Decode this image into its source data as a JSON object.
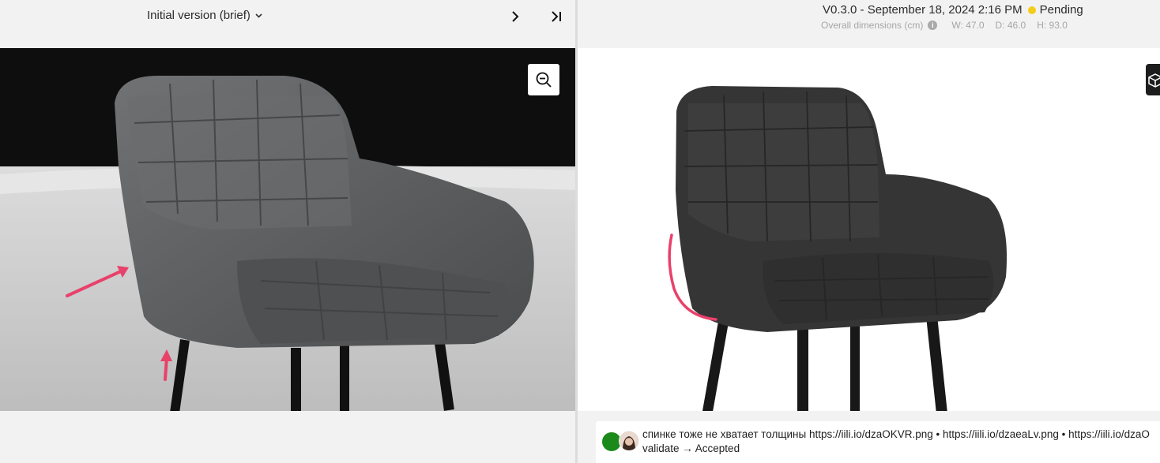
{
  "left_panel": {
    "version_label": "Initial version (brief)",
    "icons": {
      "dropdown": "chevron-down-icon",
      "next": "chevron-right-icon",
      "last": "skip-to-end-icon",
      "zoom": "zoom-out-icon"
    }
  },
  "right_panel": {
    "version_info": "V0.3.0 - September 18, 2024 2:16 PM",
    "status": "Pending",
    "status_color": "#f4cd1a",
    "dimensions_label": "Overall dimensions (cm)",
    "dimensions": {
      "w": "W: 47.0",
      "d": "D: 46.0",
      "h": "H: 93.0"
    },
    "icons": {
      "info": "info-icon",
      "view_3d": "cube-icon"
    }
  },
  "comment": {
    "text": "спинке тоже не хватает толщины https://iili.io/dzaOKVR.png • https://iili.io/dzaeaLv.png • https://iili.io/dzaO",
    "status": "validate → Accepted",
    "avatar_color": "#1b8a1b"
  },
  "colors": {
    "annotation": "#e8416a",
    "page_bg": "#f2f2f2"
  }
}
